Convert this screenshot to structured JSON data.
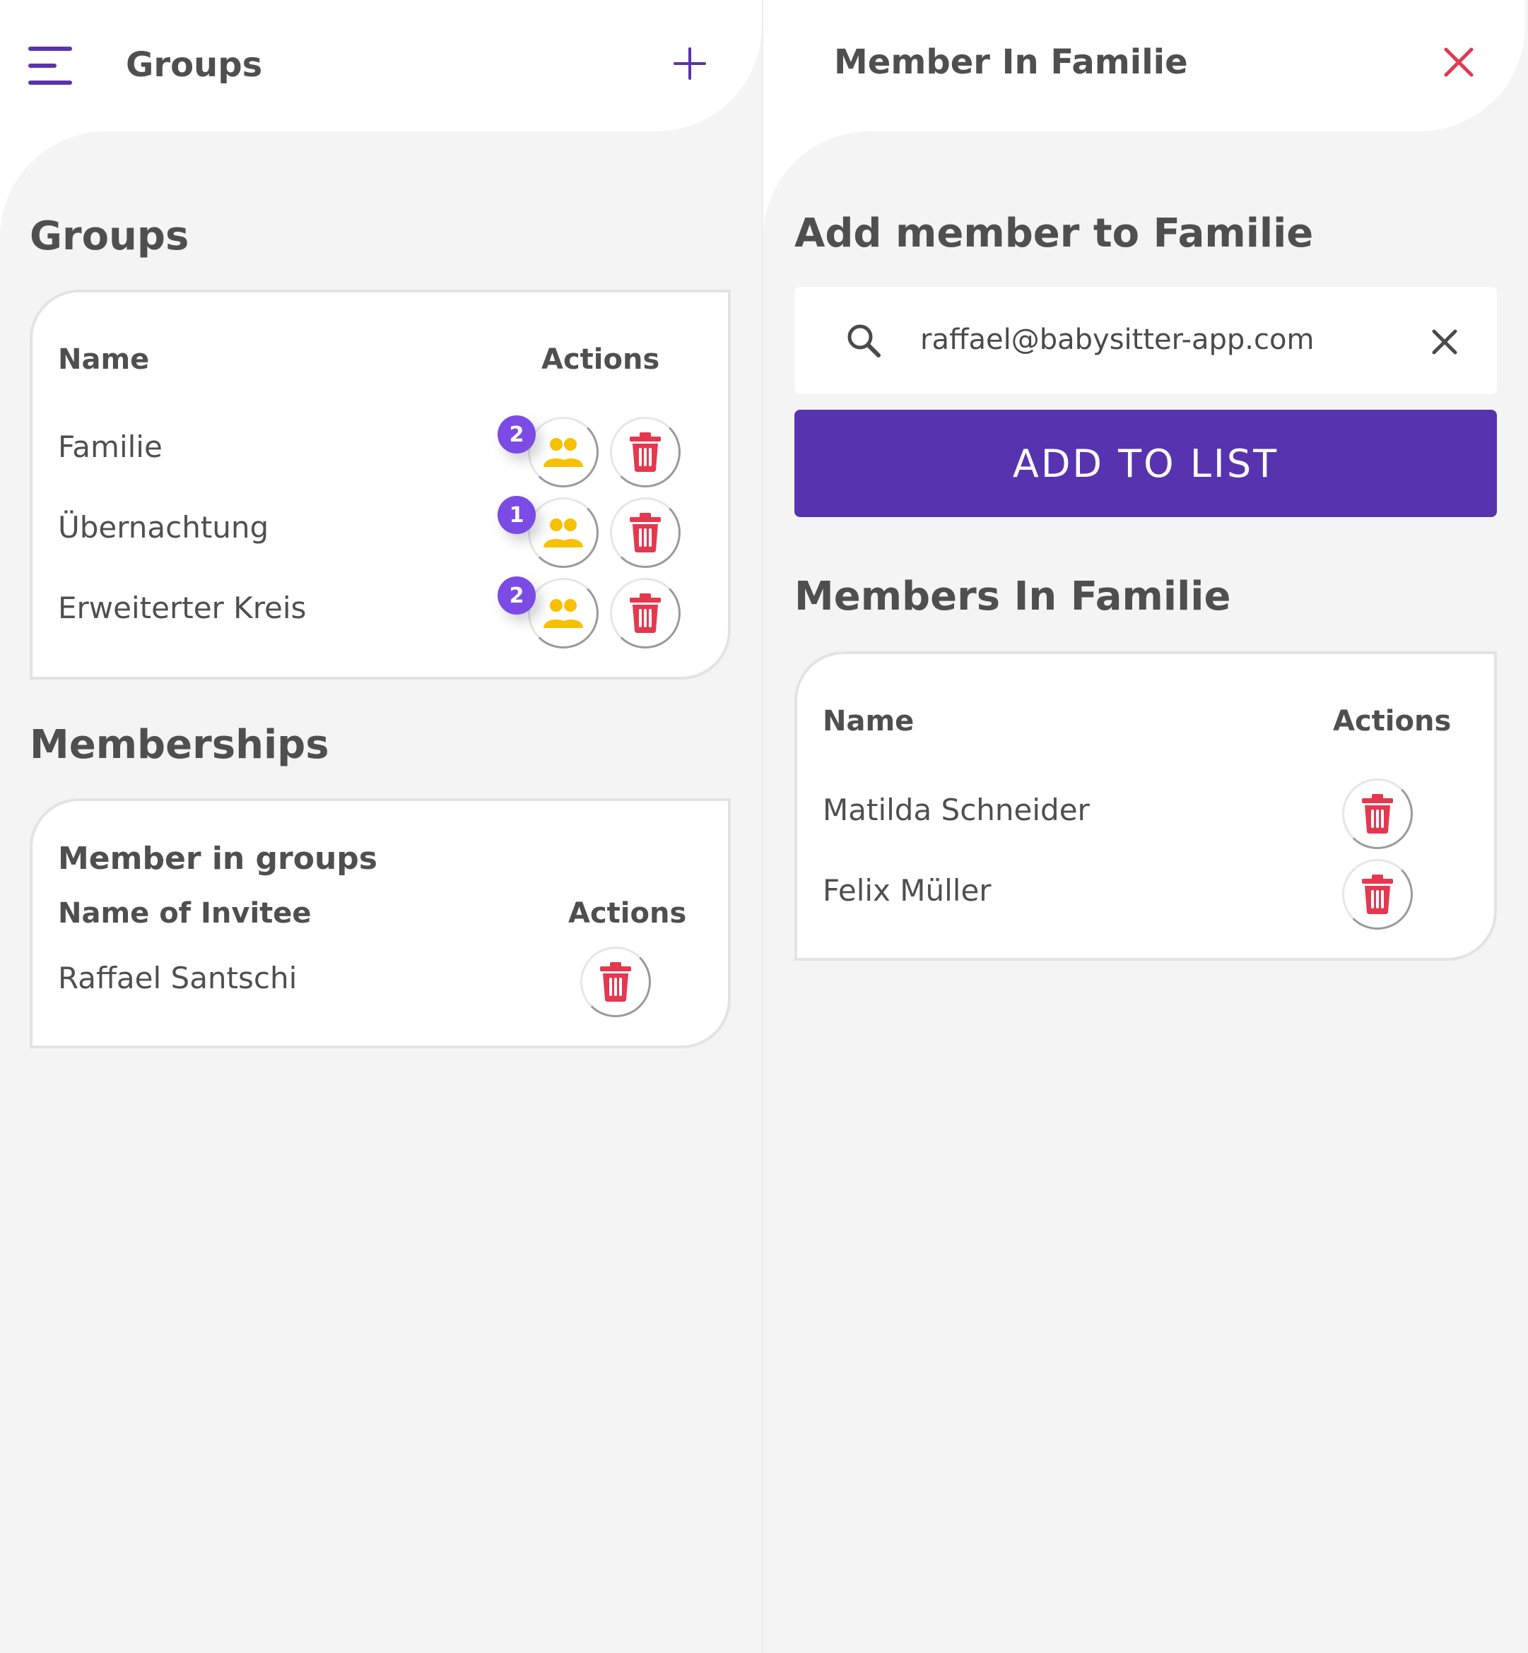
{
  "left": {
    "header": {
      "title": "Groups"
    },
    "groups": {
      "heading": "Groups",
      "table": {
        "col_name": "Name",
        "col_actions": "Actions",
        "rows": [
          {
            "name": "Familie",
            "member_count": "2"
          },
          {
            "name": "Übernachtung",
            "member_count": "1"
          },
          {
            "name": "Erweiterter Kreis",
            "member_count": "2"
          }
        ]
      }
    },
    "memberships": {
      "heading": "Memberships",
      "card_title": "Member in groups",
      "col_name": "Name of Invitee",
      "col_actions": "Actions",
      "rows": [
        {
          "name": "Raffael Santschi"
        }
      ]
    }
  },
  "right": {
    "header": {
      "title": "Member In Familie"
    },
    "add_heading": "Add member to Familie",
    "search": {
      "value": "raffael@babysitter-app.com"
    },
    "add_button": "ADD TO LIST",
    "members": {
      "heading": "Members In Familie",
      "col_name": "Name",
      "col_actions": "Actions",
      "rows": [
        {
          "name": "Matilda Schneider"
        },
        {
          "name": "Felix Müller"
        }
      ]
    }
  },
  "colors": {
    "primary": "#5833b0",
    "badge": "#7c4be5",
    "delete": "#e5384f",
    "group_icon": "#f7c000",
    "close": "#e5384f"
  },
  "icons": {
    "menu": "menu-icon",
    "add": "plus-icon",
    "close": "close-icon",
    "search": "search-icon",
    "clear": "clear-icon",
    "members": "group-icon",
    "delete": "trash-icon"
  }
}
